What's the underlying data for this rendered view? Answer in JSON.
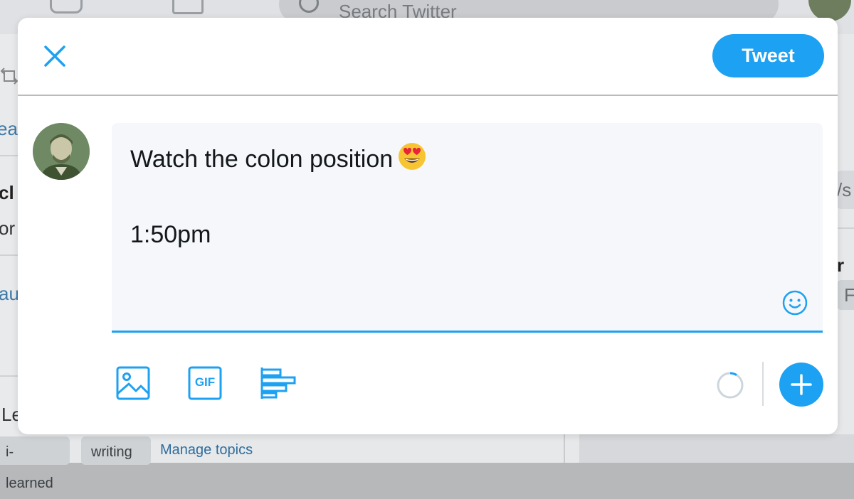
{
  "background": {
    "search_placeholder": "Search Twitter",
    "left_fragments": [
      "ea",
      "cl",
      "or",
      "au",
      "Le"
    ],
    "right_fragments": [
      "/s",
      "r",
      "F"
    ],
    "topic_chips": [
      "i-learned",
      "writing"
    ],
    "manage_topics_label": "Manage topics"
  },
  "modal": {
    "close_icon": "close-icon",
    "tweet_button_label": "Tweet",
    "compose": {
      "line1": "Watch the colon position",
      "emoji": "smiling-face-with-heart-eyes",
      "line2": "1:50pm"
    },
    "toolbar": {
      "media_icon": "image-icon",
      "gif_label": "GIF",
      "poll_icon": "poll-icon",
      "emoji_icon": "smiley-icon",
      "add_icon": "plus-icon"
    }
  },
  "colors": {
    "accent": "#1da1f2",
    "text": "#14171a",
    "compose_bg": "#f5f7fa"
  }
}
